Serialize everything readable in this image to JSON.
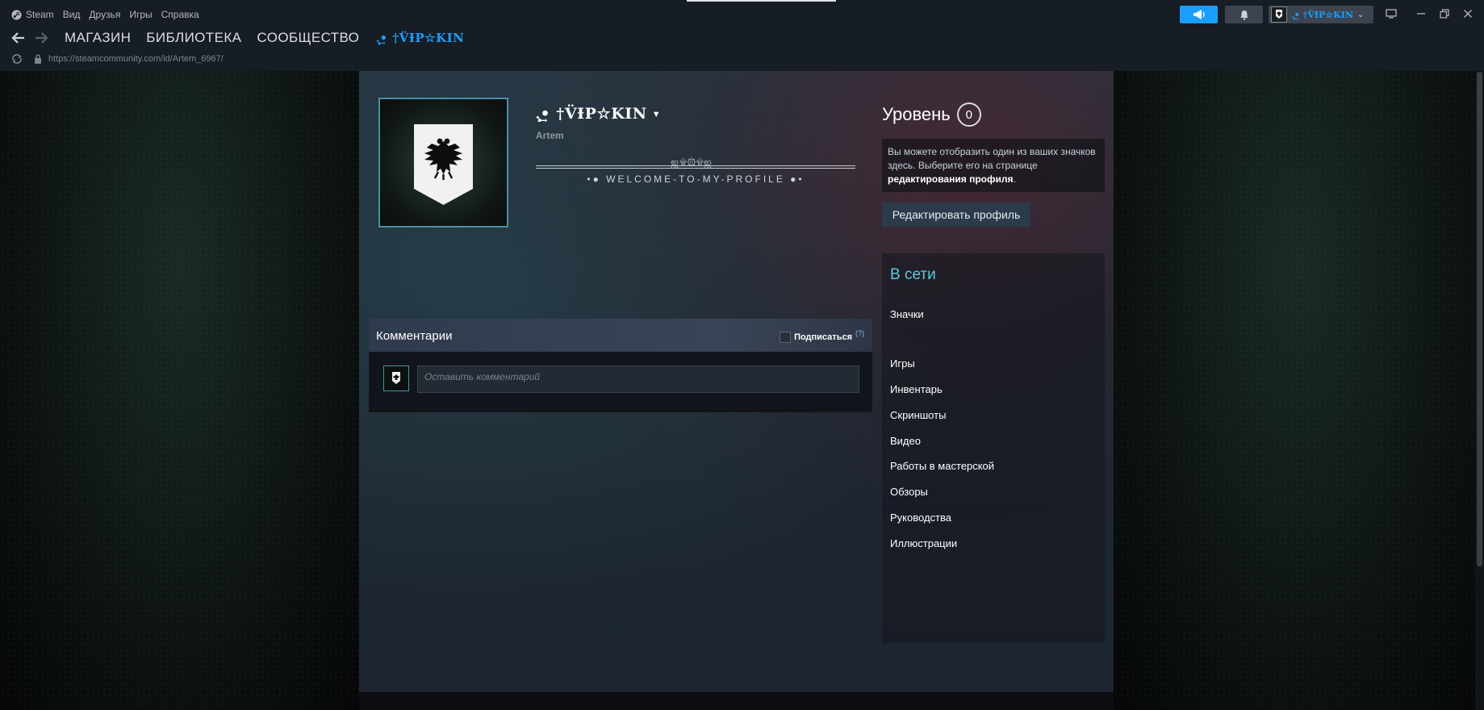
{
  "titlebar": {
    "app_name": "Steam",
    "menu": [
      "Вид",
      "Друзья",
      "Игры",
      "Справка"
    ],
    "nav": [
      "МАГАЗИН",
      "БИБЛИОТЕКА",
      "СООБЩЕСТВО"
    ],
    "nav_username": ".̧̥͢• †V̈ƗP☆KIN",
    "url": "https://steamcommunity.com/id/Artem_6967/",
    "account_name": ".̧̥͢• †V̈ƗP☆KIN"
  },
  "profile": {
    "persona_name": ".̧̥͢• †V̈ƗP☆KIN",
    "real_name": "Artem",
    "summary_ornament": "ஜ۩۞۩ஜ",
    "summary_text": "•● WELCOME-TO-MY-PROFILE ●•"
  },
  "comments": {
    "title": "Комментарии",
    "subscribe_label": "Подписаться",
    "help_mark": "(?)",
    "placeholder": "Оставить комментарий"
  },
  "sidebar": {
    "level_label": "Уровень",
    "level_value": "0",
    "badge_hint_text": "Вы можете отобразить один из ваших значков здесь. Выберите его на странице ",
    "badge_hint_link": "редактирования профиля",
    "badge_hint_end": ".",
    "edit_button": "Редактировать профиль",
    "status": "В сети",
    "links": [
      "Значки",
      "Игры",
      "Инвентарь",
      "Скриншоты",
      "Видео",
      "Работы в мастерской",
      "Обзоры",
      "Руководства",
      "Иллюстрации"
    ]
  },
  "colors": {
    "accent_blue": "#1a9fff",
    "online_status": "#57cbde",
    "titlebar_bg": "#171d25"
  },
  "icons": [
    "steam-icon",
    "back-arrow-icon",
    "forward-arrow-icon",
    "reload-icon",
    "lock-icon",
    "announcement-icon",
    "bell-icon",
    "eagle-emblem-icon",
    "monitor-icon",
    "minimize-icon",
    "restore-icon",
    "close-icon"
  ]
}
